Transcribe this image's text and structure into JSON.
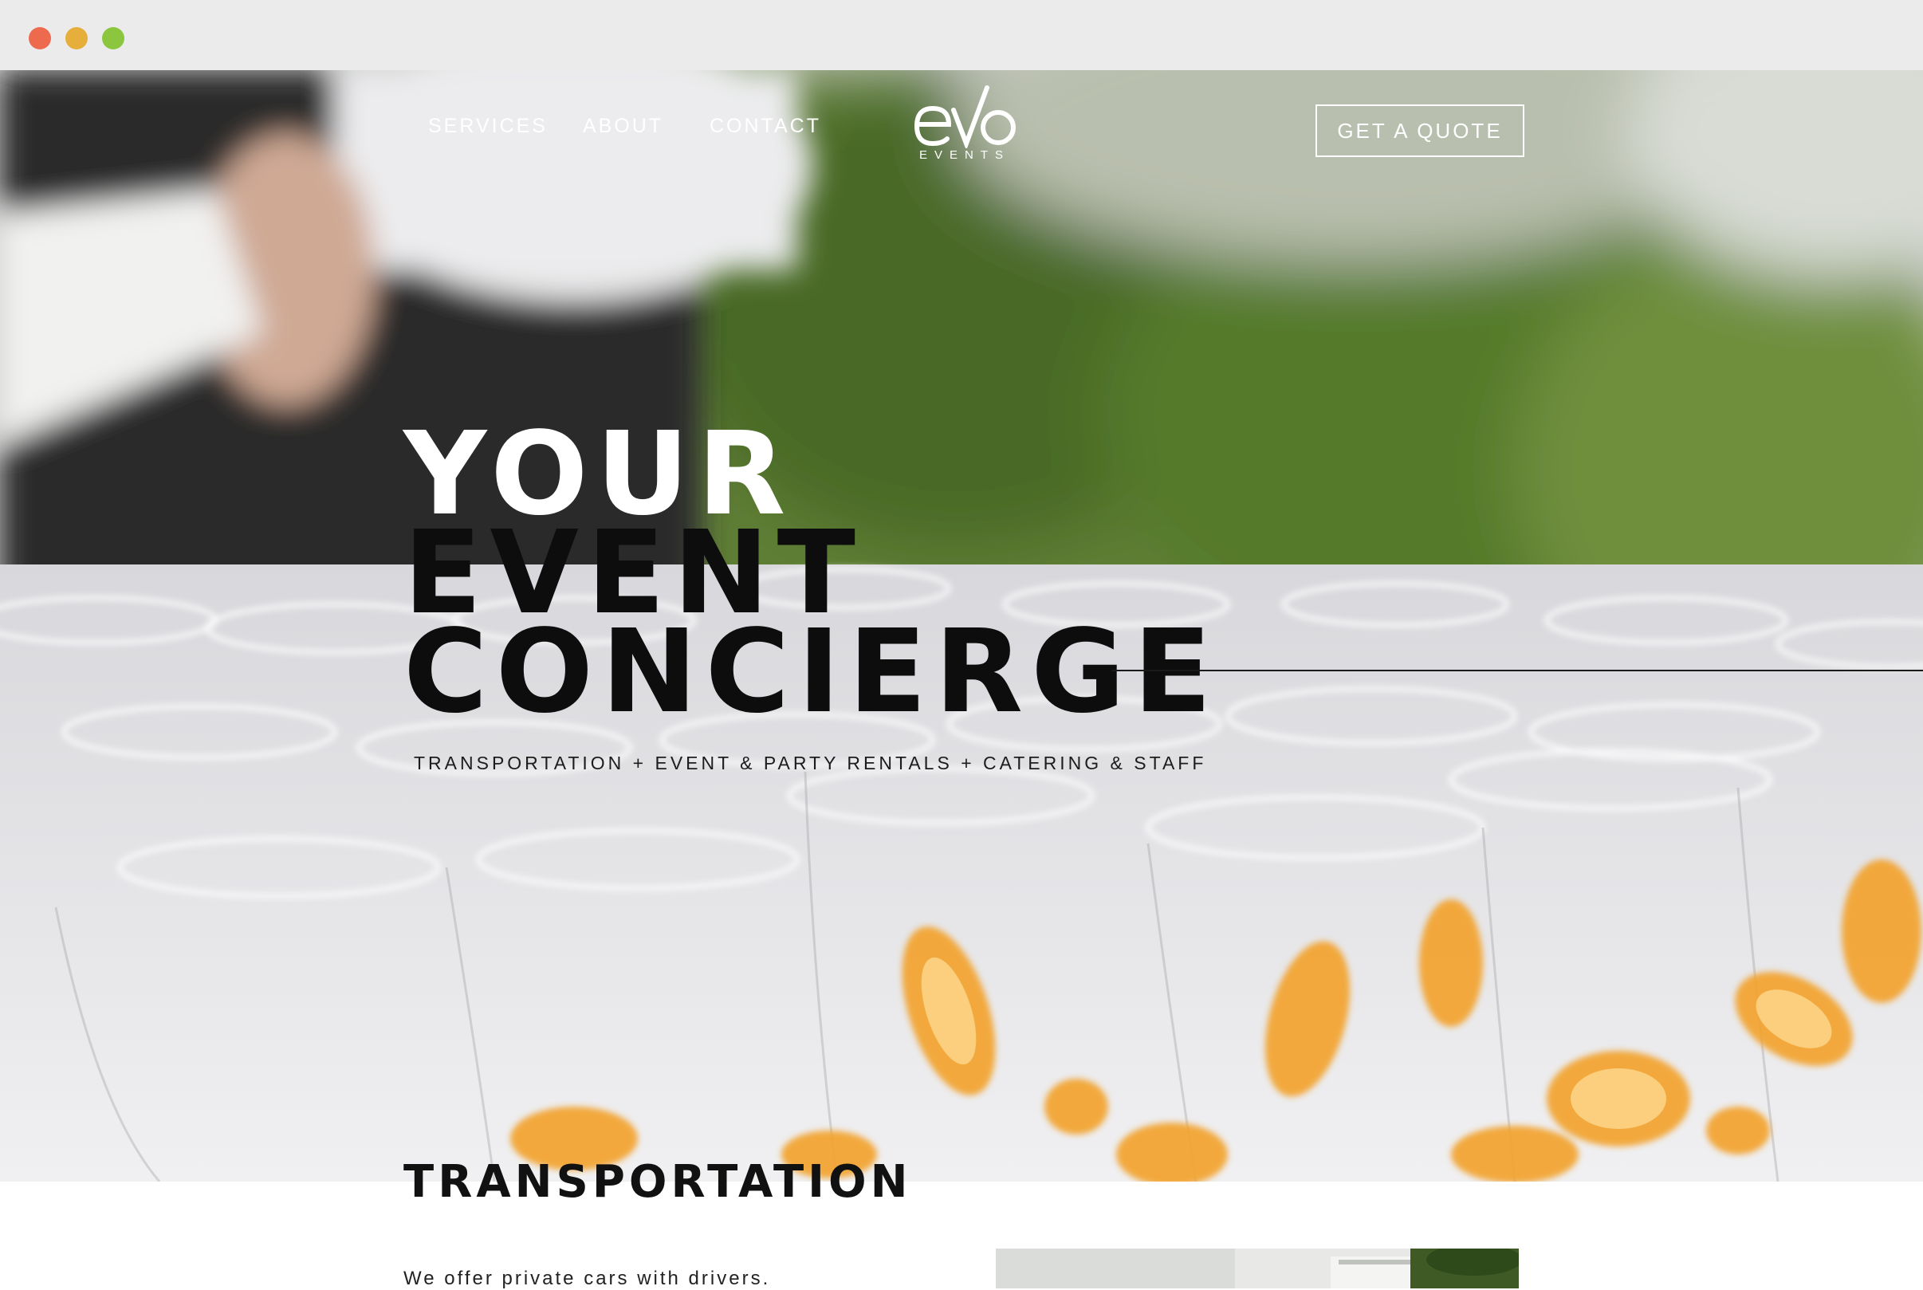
{
  "window": {
    "controls": [
      "close",
      "minimize",
      "maximize"
    ]
  },
  "nav": {
    "links": [
      "SERVICES",
      "ABOUT",
      "CONTACT"
    ],
    "cta": "GET A QUOTE"
  },
  "logo": {
    "mark": "eVo",
    "sub": "EVENTS"
  },
  "hero": {
    "line1": "YOUR",
    "line2": "EVENT",
    "line3": "CONCIERGE",
    "tagline": "TRANSPORTATION + EVENT & PARTY RENTALS + CATERING & STAFF"
  },
  "section": {
    "title": "TRANSPORTATION",
    "text": "We offer private cars with drivers."
  },
  "colors": {
    "accent_orange": "#f2a22c",
    "foliage": "#5b7a30",
    "chrome": "#ebebeb"
  }
}
